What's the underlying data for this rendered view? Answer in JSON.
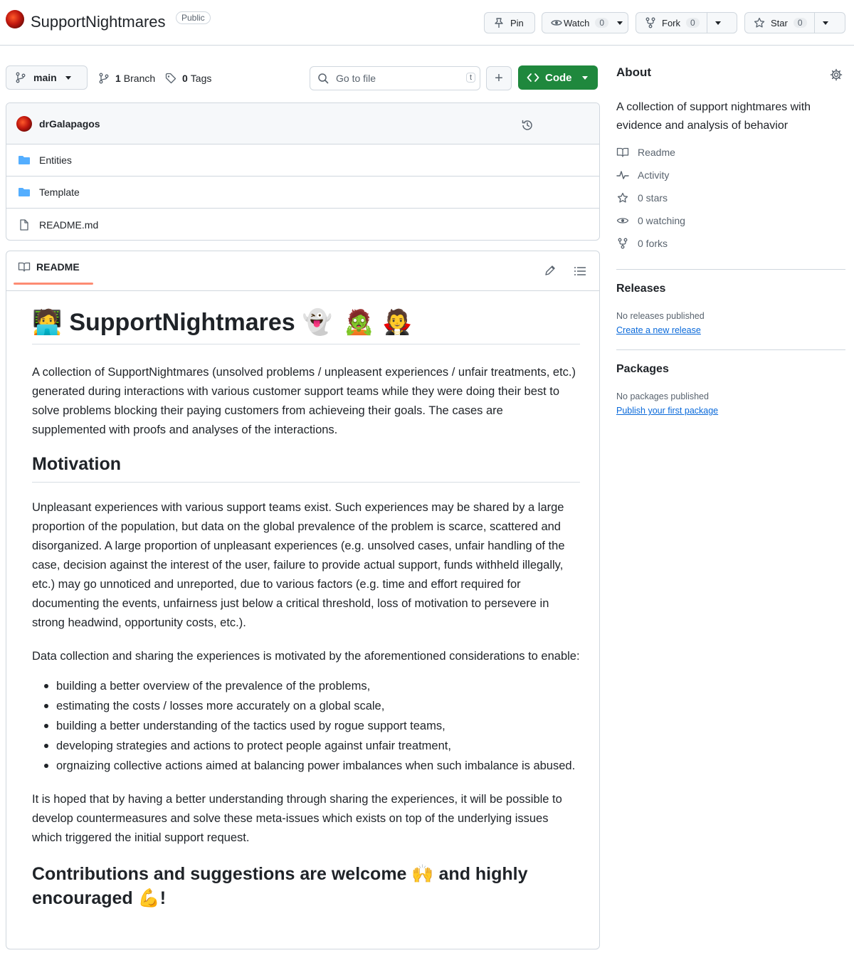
{
  "repo": {
    "name": "SupportNightmares",
    "visibility": "Public"
  },
  "actions": {
    "pin_label": "Pin",
    "watch_label": "Watch",
    "watch_count": "0",
    "fork_label": "Fork",
    "fork_count": "0",
    "star_label": "Star",
    "star_count": "0"
  },
  "toolbar": {
    "branch": "main",
    "branches_count": "1",
    "branches_label": "Branch",
    "tags_count": "0",
    "tags_label": "Tags",
    "search_placeholder": "Go to file",
    "search_kbd": "t",
    "add_label": "+",
    "code_label": "Code"
  },
  "commit": {
    "author": "drGalapagos"
  },
  "files": [
    {
      "name": "Entities",
      "type": "folder"
    },
    {
      "name": "Template",
      "type": "folder"
    },
    {
      "name": "README.md",
      "type": "file"
    }
  ],
  "readme": {
    "tab_label": "README",
    "title": "SupportNightmares",
    "title_emoji_left": "🧑‍💻",
    "title_emojis_right": [
      "👻",
      "🧟",
      "🧛"
    ],
    "intro": "A collection of SupportNightmares (unsolved problems / unpleasent experiences / unfair treatments, etc.) generated during interactions with various customer support teams while they were doing their best to solve problems blocking their paying customers from achieveing their goals. The cases are supplemented with proofs and analyses of the interactions.",
    "motivation_heading": "Motivation",
    "motivation_p1": "Unpleasant experiences with various support teams exist. Such experiences may be shared by a large proportion of the population, but data on the global prevalence of the problem is scarce, scattered and disorganized. A large proportion of unpleasant experiences (e.g. unsolved cases, unfair handling of the case, decision against the interest of the user, failure to provide actual support, funds withheld illegally, etc.) may go unnoticed and unreported, due to various factors (e.g. time and effort required for documenting the events, unfairness just below a critical threshold, loss of motivation to persevere in strong headwind, opportunity costs, etc.).",
    "motivation_p2": "Data collection and sharing the experiences is motivated by the aforementioned considerations to enable:",
    "bullets": [
      "building a better overview of the prevalence of the problems,",
      "estimating the costs / losses more accurately on a global scale,",
      "building a better understanding of the tactics used by rogue support teams,",
      "developing strategies and actions to protect people against unfair treatment,",
      "orgnaizing collective actions aimed at balancing power imbalances when such imbalance is abused."
    ],
    "closing_p": "It is hoped that by having a better understanding through sharing the experiences, it will be possible to develop countermeasures and solve these meta-issues which exists on top of the underlying issues which triggered the initial support request.",
    "contrib_part1": "Contributions and suggestions are welcome",
    "contrib_emoji1": "🙌",
    "contrib_part2": "and highly encouraged",
    "contrib_emoji2": "💪",
    "contrib_end": "!"
  },
  "about": {
    "title": "About",
    "description": "A collection of support nightmares with evidence and analysis of behavior",
    "stats": [
      {
        "icon": "book-icon",
        "label": "Readme"
      },
      {
        "icon": "pulse-icon",
        "label": "Activity"
      },
      {
        "icon": "star-icon",
        "label": "0 stars"
      },
      {
        "icon": "eye-icon",
        "label": "0 watching"
      },
      {
        "icon": "fork-icon",
        "label": "0 forks"
      }
    ]
  },
  "releases": {
    "title": "Releases",
    "empty": "No releases published",
    "link": "Create a new release"
  },
  "packages": {
    "title": "Packages",
    "empty": "No packages published",
    "link": "Publish your first package"
  }
}
